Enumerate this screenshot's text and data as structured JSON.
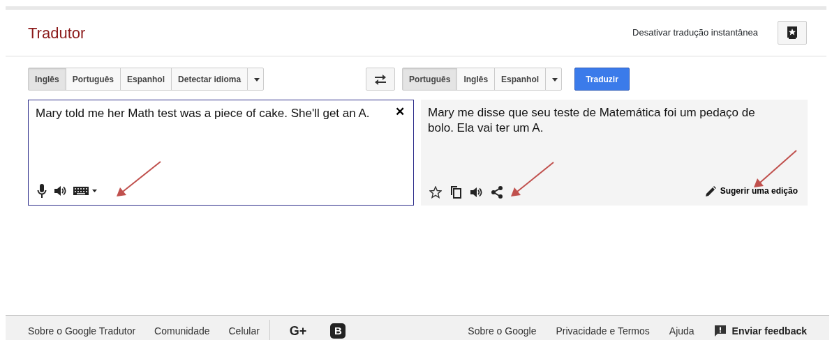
{
  "header": {
    "title": "Tradutor",
    "instant_toggle": "Desativar tradução instantânea"
  },
  "source": {
    "languages": [
      {
        "label": "Inglês",
        "selected": true
      },
      {
        "label": "Português",
        "selected": false
      },
      {
        "label": "Espanhol",
        "selected": false
      },
      {
        "label": "Detectar idioma",
        "selected": false
      }
    ],
    "text": "Mary told me her Math test was a piece of cake. She'll get an A.",
    "clear": "✕"
  },
  "target": {
    "languages": [
      {
        "label": "Português",
        "selected": true
      },
      {
        "label": "Inglês",
        "selected": false
      },
      {
        "label": "Espanhol",
        "selected": false
      }
    ],
    "translate_button": "Traduzir",
    "text": "Mary me disse que seu teste de Matemática foi um pedaço de bolo. Ela vai ter um A.",
    "suggest_edit": "Sugerir uma edição"
  },
  "footer": {
    "left_links": [
      "Sobre o Google Tradutor",
      "Comunidade",
      "Celular"
    ],
    "social": [
      "G+",
      "B"
    ],
    "right_links": [
      "Sobre o Google",
      "Privacidade e Termos",
      "Ajuda"
    ],
    "feedback": "Enviar feedback"
  }
}
